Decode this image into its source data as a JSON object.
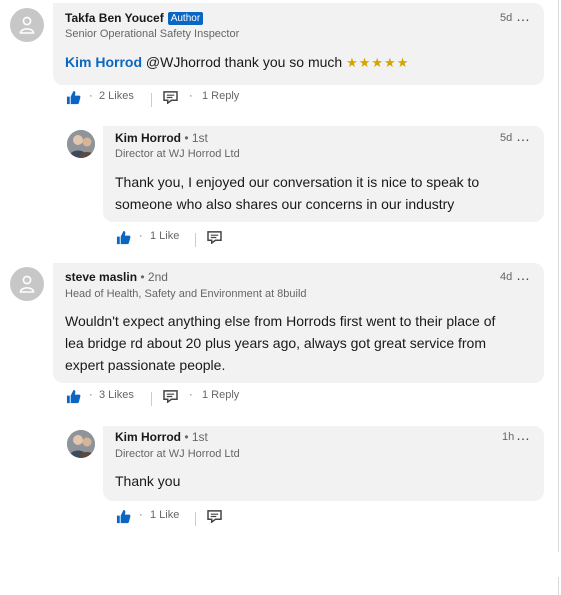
{
  "comments": [
    {
      "name": "Takfa Ben Youcef",
      "author_badge": "Author",
      "headline": "Senior Operational Safety Inspector",
      "time": "5d",
      "mention": "Kim Horrod",
      "text": "@WJhorrod  thank you so much",
      "emoji": "★★★★★",
      "likes": "2 Likes",
      "replies": "1 Reply",
      "reply": {
        "name": "Kim Horrod",
        "degree": "• 1st",
        "headline": "Director at WJ Horrod Ltd",
        "time": "5d",
        "text_line1": "Thank you, I enjoyed our conversation it is nice to speak to",
        "text_line2": "someone who also shares our concerns in our industry",
        "likes": "1 Like"
      }
    },
    {
      "name": "steve maslin",
      "degree": "• 2nd",
      "headline": "Head of Health, Safety and Environment at 8build",
      "time": "4d",
      "text_line1": "Wouldn't expect anything else from Horrods first went to their place of",
      "text_line2": "lea bridge rd about 20 plus years ago, always got great service from",
      "text_line3": "expert passionate people.",
      "likes": "3 Likes",
      "replies": "1 Reply",
      "reply": {
        "name": "Kim Horrod",
        "degree": "• 1st",
        "headline": "Director at WJ Horrod Ltd",
        "time": "1h",
        "text": "Thank you",
        "likes": "1 Like"
      }
    }
  ],
  "ui": {
    "more_glyph": "…",
    "dot": "·",
    "like_color": "#0a66c2"
  }
}
